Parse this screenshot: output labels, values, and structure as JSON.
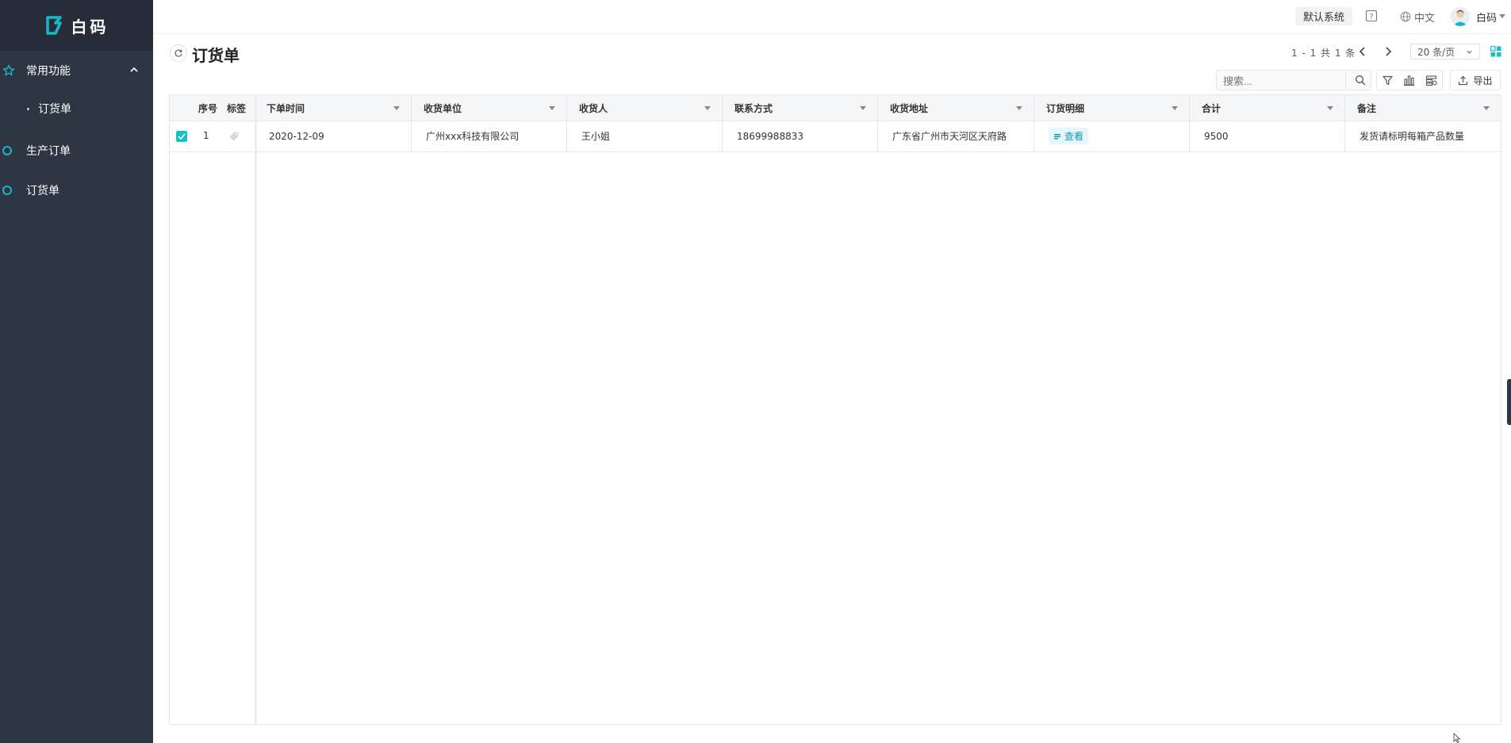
{
  "app": {
    "logo_text": "白码"
  },
  "sidebar": {
    "groups": [
      {
        "label": "常用功能",
        "expanded": true,
        "items": [
          {
            "label": "订货单"
          }
        ]
      },
      {
        "label": "生产订单"
      },
      {
        "label": "订货单"
      }
    ]
  },
  "header": {
    "system_button": "默认系统",
    "language": "中文",
    "username": "白码"
  },
  "page": {
    "title": "订货单",
    "pager_text": "1 - 1  共  1  条",
    "page_size": "20 条/页"
  },
  "toolbar": {
    "search_placeholder": "搜索...",
    "export_label": "导出"
  },
  "table": {
    "fixed_headers": {
      "index": "序号",
      "tag": "标签"
    },
    "columns": [
      "下单时间",
      "收货单位",
      "收货人",
      "联系方式",
      "收货地址",
      "订货明细",
      "合计",
      "备注"
    ],
    "rows": [
      {
        "index": "1",
        "checked": true,
        "cells": [
          "2020-12-09",
          "广州xxx科技有限公司",
          "王小姐",
          "18699988833",
          "广东省广州市天河区天府路",
          "查看",
          "9500",
          "发货请标明每箱产品数量"
        ]
      }
    ]
  },
  "colors": {
    "sidebar_bg": "#2e3643",
    "accent": "#13c2c2",
    "ring": "#16b8c8"
  }
}
